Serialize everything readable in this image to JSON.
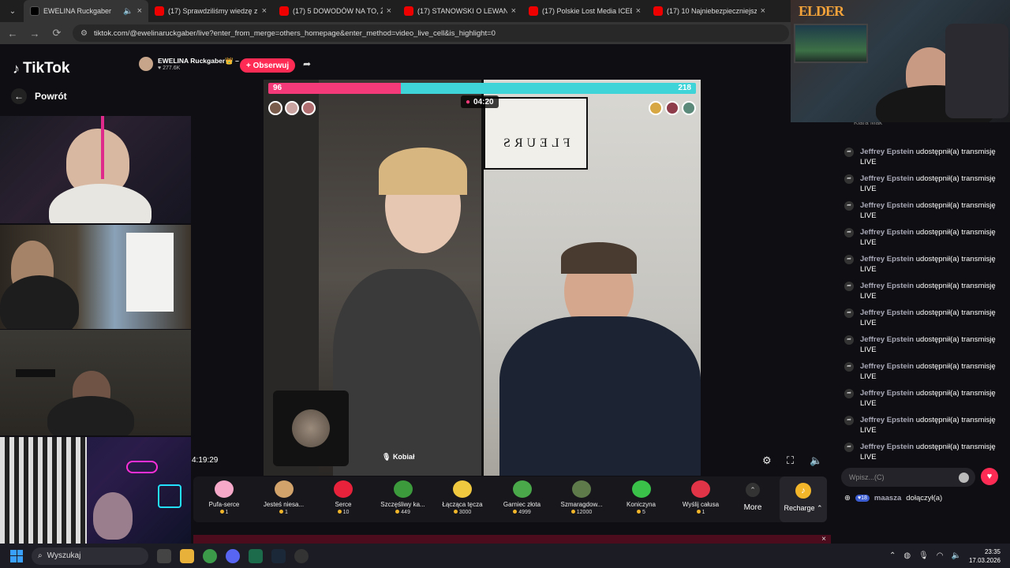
{
  "browser": {
    "tabs": [
      {
        "title": "EWELINA Ruckgaber",
        "active": true,
        "favicon": "tiktok"
      },
      {
        "title": "(17) Sprawdziliśmy wiedzę z m",
        "favicon": "youtube"
      },
      {
        "title": "(17) 5 DOWODÓW NA TO, ŻE",
        "favicon": "youtube"
      },
      {
        "title": "(17) STANOWSKI O LEWANDO",
        "favicon": "youtube"
      },
      {
        "title": "(17) Polskie Lost Media ICEBER",
        "favicon": "youtube"
      },
      {
        "title": "(17) 10 Najniebezpieczniejszych",
        "favicon": "youtube"
      }
    ],
    "url": "tiktok.com/@ewelinaruckgaber/live?enter_from_merge=others_homepage&enter_method=video_live_cell&is_highlight=0"
  },
  "sidebar": {
    "logo": "TikTok",
    "back_label": "Powrót"
  },
  "stream": {
    "host_name": "EWELINA Ruckgaber👑 –",
    "likes": "277.6K",
    "follow_label": "+ Obserwuj",
    "battle_left_score": "96",
    "battle_right_score": "218",
    "battle_left_fraction": 0.31,
    "timer": "04:20",
    "mirrored_sign": "FLEURS",
    "guest_name": "Kobiał",
    "elapsed": "4:19:29"
  },
  "gifts": [
    {
      "name": "Pufa-serce",
      "price": "1",
      "color": "#f6a9c8"
    },
    {
      "name": "Jesteś niesa...",
      "price": "1",
      "color": "#d2a36b"
    },
    {
      "name": "Serce",
      "price": "10",
      "color": "#e8223b"
    },
    {
      "name": "Szczęśliwy ka...",
      "price": "449",
      "color": "#3c9a3c"
    },
    {
      "name": "Łącząca tęcza",
      "price": "3000",
      "color": "#f0c840"
    },
    {
      "name": "Garniec złota",
      "price": "4999",
      "color": "#4aa84a"
    },
    {
      "name": "Szmaragdow...",
      "price": "12000",
      "color": "#5e7a4a"
    },
    {
      "name": "Koniczyna",
      "price": "5",
      "color": "#39c14a"
    },
    {
      "name": "Wyślij całusa",
      "price": "1",
      "color": "#e23447"
    }
  ],
  "gift_more": "More",
  "recharge": "Recharge",
  "chat": {
    "top_user": "Klara Mak",
    "messages": [
      {
        "user": "Jeffrey Epstein",
        "text": "udostępnił(a) transmisję LIVE"
      },
      {
        "user": "Jeffrey Epstein",
        "text": "udostępnił(a) transmisję LIVE"
      },
      {
        "user": "Jeffrey Epstein",
        "text": "udostępnił(a) transmisję LIVE"
      },
      {
        "user": "Jeffrey Epstein",
        "text": "udostępnił(a) transmisję LIVE"
      },
      {
        "user": "Jeffrey Epstein",
        "text": "udostępnił(a) transmisję LIVE"
      },
      {
        "user": "Jeffrey Epstein",
        "text": "udostępnił(a) transmisję LIVE"
      },
      {
        "user": "Jeffrey Epstein",
        "text": "udostępnił(a) transmisję LIVE"
      },
      {
        "user": "Jeffrey Epstein",
        "text": "udostępnił(a) transmisję LIVE"
      },
      {
        "user": "Jeffrey Epstein",
        "text": "udostępnił(a) transmisję LIVE"
      },
      {
        "user": "Jeffrey Epstein",
        "text": "udostępnił(a) transmisję LIVE"
      },
      {
        "user": "Jeffrey Epstein",
        "text": "udostępnił(a) transmisję LIVE"
      },
      {
        "user": "Jeffrey Epstein",
        "text": "udostępnił(a) transmisję LIVE"
      }
    ],
    "joined_level": "18",
    "joined_user": "maasza",
    "joined_text": "dołączył(a)",
    "input_placeholder": "Wpisz...(C)"
  },
  "webcam_overlay_text": "ELDER",
  "taskbar": {
    "search_label": "Wyszukaj",
    "time": "23:35",
    "date": "17.03.2026"
  }
}
